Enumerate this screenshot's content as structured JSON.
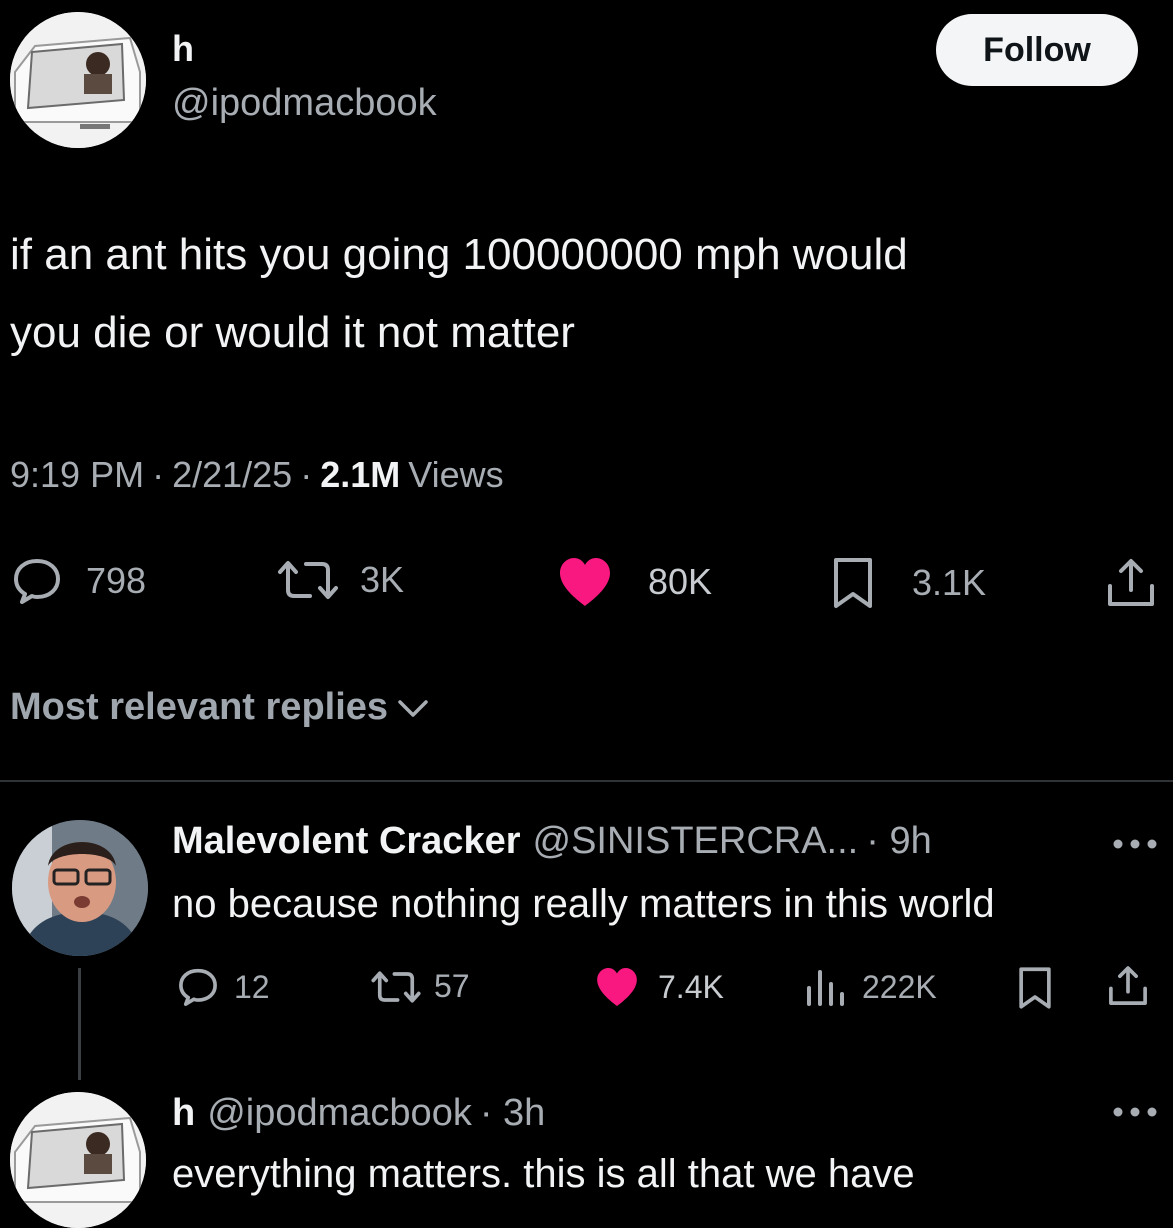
{
  "tweet": {
    "author": {
      "name": "h",
      "handle": "@ipodmacbook"
    },
    "follow_label": "Follow",
    "text_line1": "if an ant hits you going 100000000 mph would",
    "text_line2": "you die or would it not matter",
    "time": "9:19 PM",
    "date": "2/21/25",
    "sep": "·",
    "views_count": "2.1M",
    "views_label": "Views",
    "stats": {
      "replies": "798",
      "reposts": "3K",
      "likes": "80K",
      "bookmarks": "3.1K"
    }
  },
  "replies_sort": {
    "label": "Most relevant replies"
  },
  "replies": [
    {
      "name": "Malevolent Cracker",
      "handle": "@SINISTERCRA...",
      "time": "· 9h",
      "text": "no because nothing really matters in this world",
      "stats": {
        "replies": "12",
        "reposts": "57",
        "likes": "7.4K",
        "views": "222K"
      }
    },
    {
      "name": "h",
      "handle": "@ipodmacbook",
      "time": "· 3h",
      "text": "everything matters. this is all that we have"
    }
  ],
  "colors": {
    "like": "#f91880",
    "background": "#000000",
    "muted": "#a7adb3",
    "divider": "#2f3336"
  },
  "icons": [
    "reply-icon",
    "repost-icon",
    "like-icon",
    "bookmark-icon",
    "share-icon",
    "views-icon",
    "more-icon",
    "chevron-down-icon"
  ]
}
